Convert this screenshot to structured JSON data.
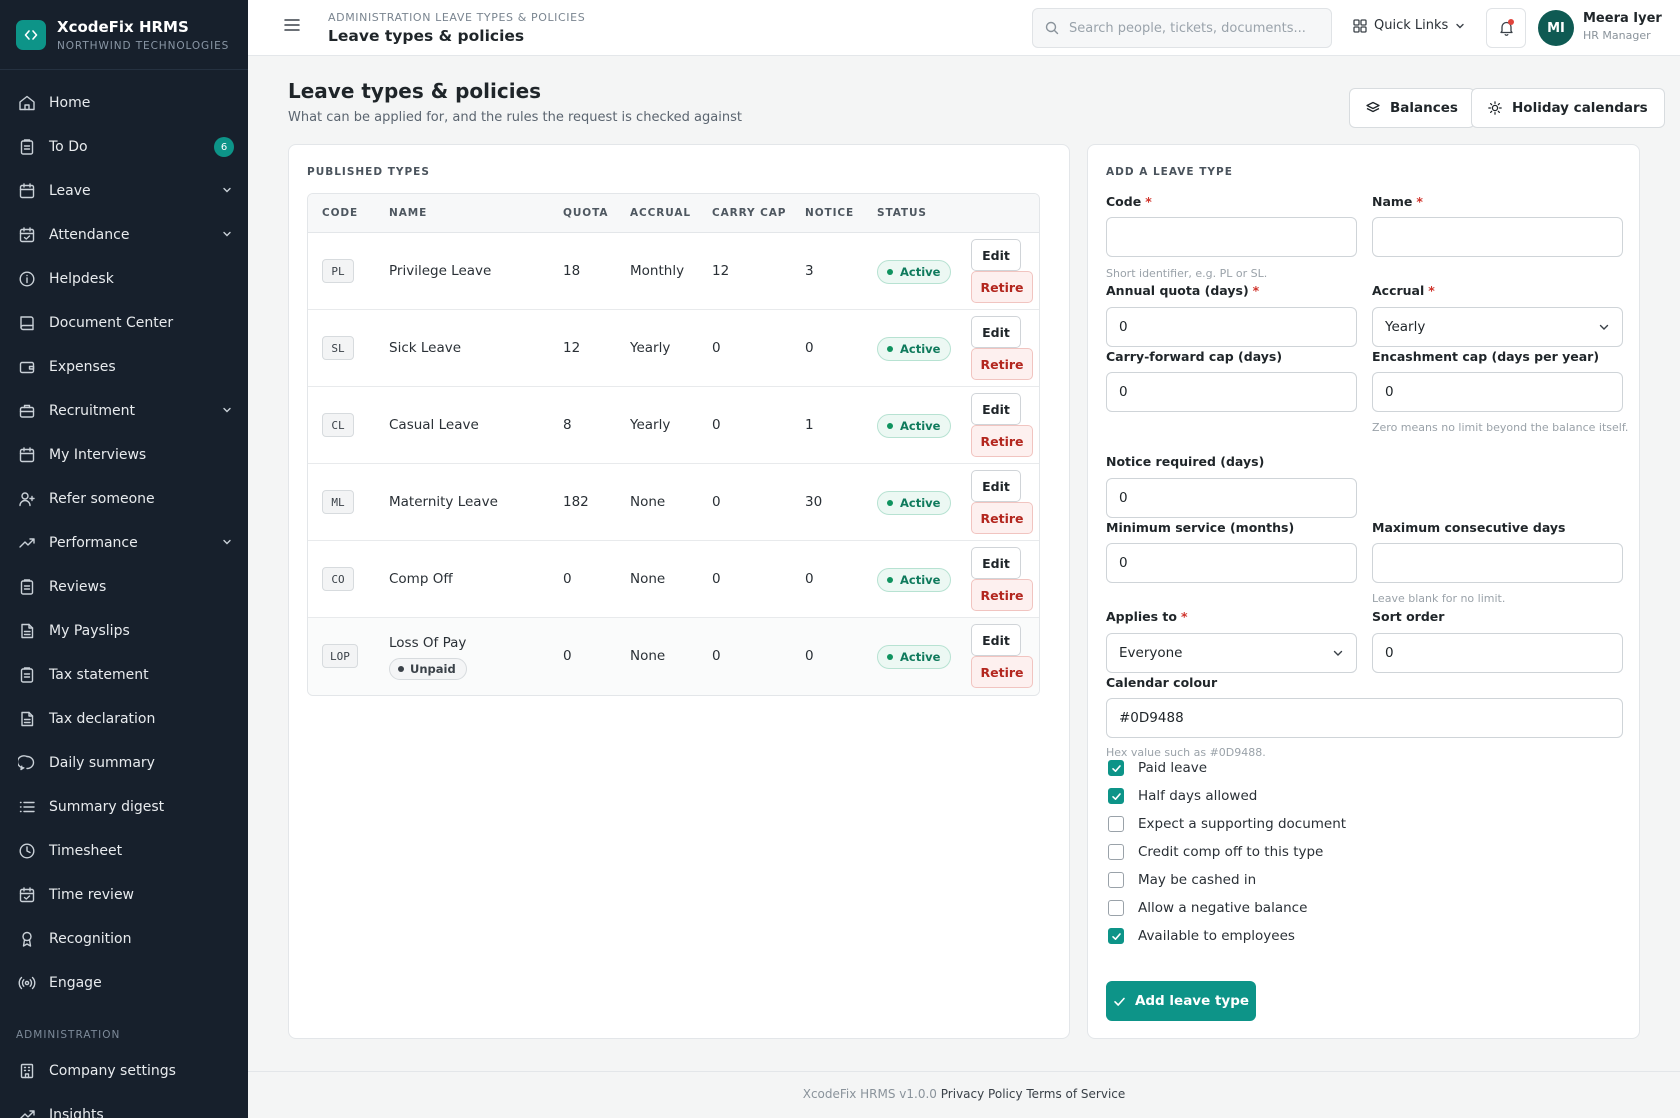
{
  "brand": {
    "name": "XcodeFix HRMS",
    "company": "NORTHWIND TECHNOLOGIES",
    "logo_glyph": "‹ ›",
    "accent": "#0d9488"
  },
  "sidebar": {
    "items": [
      {
        "label": "Home",
        "icon": "home-icon"
      },
      {
        "label": "To Do",
        "icon": "clipboard-icon",
        "badge": "6"
      },
      {
        "label": "Leave",
        "icon": "calendar-icon",
        "expandable": true
      },
      {
        "label": "Attendance",
        "icon": "calendar-check-icon",
        "expandable": true
      },
      {
        "label": "Helpdesk",
        "icon": "info-icon"
      },
      {
        "label": "Document Center",
        "icon": "book-icon"
      },
      {
        "label": "Expenses",
        "icon": "wallet-icon"
      },
      {
        "label": "Recruitment",
        "icon": "briefcase-icon",
        "expandable": true
      },
      {
        "label": "My Interviews",
        "icon": "calendar-icon"
      },
      {
        "label": "Refer someone",
        "icon": "user-plus-icon"
      },
      {
        "label": "Performance",
        "icon": "trending-up-icon",
        "expandable": true
      },
      {
        "label": "Reviews",
        "icon": "clipboard-icon"
      },
      {
        "label": "My Payslips",
        "icon": "file-icon"
      },
      {
        "label": "Tax statement",
        "icon": "clipboard-icon"
      },
      {
        "label": "Tax declaration",
        "icon": "file-icon"
      },
      {
        "label": "Daily summary",
        "icon": "message-icon"
      },
      {
        "label": "Summary digest",
        "icon": "list-icon"
      },
      {
        "label": "Timesheet",
        "icon": "clock-icon"
      },
      {
        "label": "Time review",
        "icon": "calendar-check-icon"
      },
      {
        "label": "Recognition",
        "icon": "award-icon"
      },
      {
        "label": "Engage",
        "icon": "broadcast-icon"
      }
    ],
    "admin_section": "ADMINISTRATION",
    "admin_items": [
      {
        "label": "Company settings",
        "icon": "building-icon"
      },
      {
        "label": "Insights",
        "icon": "trending-up-icon"
      }
    ]
  },
  "topbar": {
    "breadcrumb": "ADMINISTRATION LEAVE TYPES & POLICIES",
    "title": "Leave types & policies",
    "search_placeholder": "Search people, tickets, documents...",
    "quick_links": "Quick Links",
    "user": {
      "initials": "MI",
      "name": "Meera Iyer",
      "role": "HR Manager"
    }
  },
  "page": {
    "title": "Leave types & policies",
    "subtitle": "What can be applied for, and the rules the request is checked against",
    "balances_button": "Balances",
    "holidays_button": "Holiday calendars"
  },
  "published": {
    "title": "PUBLISHED TYPES",
    "columns": {
      "code": "CODE",
      "name": "NAME",
      "quota": "QUOTA",
      "accrual": "ACCRUAL",
      "carry": "CARRY CAP",
      "notice": "NOTICE",
      "status": "STATUS"
    },
    "edit_label": "Edit",
    "retire_label": "Retire",
    "rows": [
      {
        "code": "PL",
        "name": "Privilege Leave",
        "quota": "18",
        "accrual": "Monthly",
        "carry": "12",
        "notice": "3",
        "status": "Active"
      },
      {
        "code": "SL",
        "name": "Sick Leave",
        "quota": "12",
        "accrual": "Yearly",
        "carry": "0",
        "notice": "0",
        "status": "Active"
      },
      {
        "code": "CL",
        "name": "Casual Leave",
        "quota": "8",
        "accrual": "Yearly",
        "carry": "0",
        "notice": "1",
        "status": "Active"
      },
      {
        "code": "ML",
        "name": "Maternity Leave",
        "quota": "182",
        "accrual": "None",
        "carry": "0",
        "notice": "30",
        "status": "Active"
      },
      {
        "code": "CO",
        "name": "Comp Off",
        "quota": "0",
        "accrual": "None",
        "carry": "0",
        "notice": "0",
        "status": "Active"
      },
      {
        "code": "LOP",
        "name": "Loss Of Pay",
        "tag": "Unpaid",
        "quota": "0",
        "accrual": "None",
        "carry": "0",
        "notice": "0",
        "status": "Active"
      }
    ]
  },
  "form": {
    "title": "ADD A LEAVE TYPE",
    "code_label": "Code",
    "code_value": "",
    "code_hint": "Short identifier, e.g. PL or SL.",
    "name_label": "Name",
    "name_value": "",
    "quota_label": "Annual quota (days)",
    "quota_value": "0",
    "accrual_label": "Accrual",
    "accrual_value": "Yearly",
    "carry_label": "Carry-forward cap (days)",
    "carry_value": "0",
    "encash_label": "Encashment cap (days per year)",
    "encash_value": "0",
    "encash_hint": "Zero means no limit beyond the balance itself.",
    "notice_label": "Notice required (days)",
    "notice_value": "0",
    "minservice_label": "Minimum service (months)",
    "minservice_value": "0",
    "maxconsec_label": "Maximum consecutive days",
    "maxconsec_value": "",
    "maxconsec_hint": "Leave blank for no limit.",
    "applies_label": "Applies to",
    "applies_value": "Everyone",
    "sort_label": "Sort order",
    "sort_value": "0",
    "colour_label": "Calendar colour",
    "colour_value": "#0D9488",
    "colour_hint": "Hex value such as #0D9488.",
    "checkboxes": [
      {
        "label": "Paid leave",
        "checked": true
      },
      {
        "label": "Half days allowed",
        "checked": true
      },
      {
        "label": "Expect a supporting document",
        "checked": false
      },
      {
        "label": "Credit comp off to this type",
        "checked": false
      },
      {
        "label": "May be cashed in",
        "checked": false
      },
      {
        "label": "Allow a negative balance",
        "checked": false
      },
      {
        "label": "Available to employees",
        "checked": true
      }
    ],
    "submit_label": "Add leave type"
  },
  "footer": {
    "version": "XcodeFix HRMS v1.0.0",
    "privacy": "Privacy Policy",
    "terms": "Terms of Service"
  }
}
